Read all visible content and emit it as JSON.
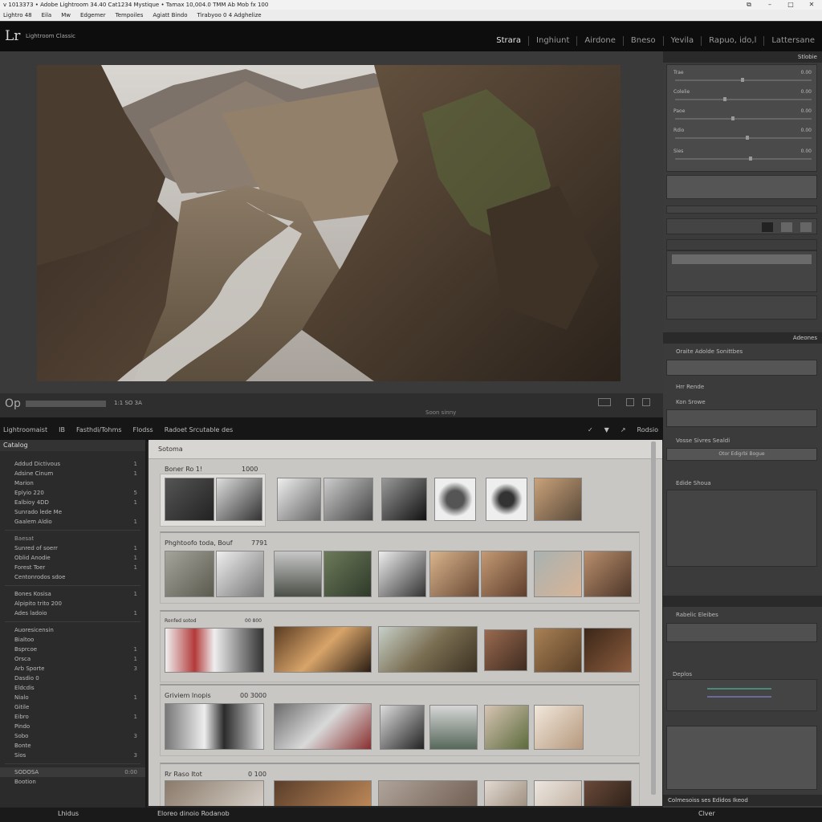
{
  "window": {
    "title": "v 1013373 • Adobe Lightroom 34.40 Cat1234 Mystique • Tamax 10,004.0 TMM Ab Mob fx 100",
    "controls": [
      "⧉",
      "–",
      "□",
      "✕"
    ]
  },
  "menubar": [
    "Lightro 48",
    "Eila",
    "Mw",
    "Edgemer",
    "Tempoiles",
    "Agiatt Bindo",
    "Tirabyoo 0 4 Adghelize"
  ],
  "identity": {
    "logo": "Lr",
    "brand": "Lightroom Classic",
    "modules": [
      "Strara",
      "Inghiunt",
      "Airdone",
      "Bneso",
      "Yevila",
      "Rapuo, ido,l",
      "Lattersane"
    ],
    "active_module": "Strara"
  },
  "toolbar": {
    "left_label": "Op",
    "zoom_text": "1:1 SO 3A",
    "center_text": "Soon sinny"
  },
  "filmstrip_bar": {
    "items": [
      "Lightroomaist",
      "IB",
      "Fasthdi/Tohms",
      "Flodss",
      "Radoet Srcutable des"
    ],
    "right": [
      "✓",
      "▼",
      "↗",
      "Rodsio"
    ]
  },
  "left_panel": {
    "header": "Catalog",
    "group1": [
      {
        "label": "Addud Dictivous",
        "count": "1"
      },
      {
        "label": "Adsine Cinum",
        "count": "1"
      },
      {
        "label": "Marion",
        "count": ""
      },
      {
        "label": "Eplyio 220",
        "count": "5"
      },
      {
        "label": "Ealbioy 4DD",
        "count": "1"
      },
      {
        "label": "Sunrado lede Me",
        "count": ""
      },
      {
        "label": "Gaalem Aldio",
        "count": "1"
      }
    ],
    "group2_label": "Baesat",
    "group2": [
      {
        "label": "Sunred of soerr",
        "count": "1"
      },
      {
        "label": "Oblid Anodie",
        "count": "1"
      },
      {
        "label": "Forest Toer",
        "count": "1"
      },
      {
        "label": "Centonrodos sdoe",
        "count": ""
      }
    ],
    "group3": [
      {
        "label": "Bones Kosisa",
        "count": "1"
      },
      {
        "label": "Alpipito trito 200",
        "count": ""
      },
      {
        "label": "Ades ladoio",
        "count": "1"
      }
    ],
    "group4_label": "Auoresicensin",
    "group4": [
      {
        "label": "Bialtoo",
        "count": ""
      },
      {
        "label": "Bsprcoe",
        "count": "1"
      },
      {
        "label": "Orsca",
        "count": "1"
      },
      {
        "label": "Arb Sporte",
        "count": "3"
      },
      {
        "label": "Dasdio 0",
        "count": ""
      },
      {
        "label": "Eldcdis",
        "count": ""
      },
      {
        "label": "Nialo",
        "count": "1"
      },
      {
        "label": "Gitile",
        "count": ""
      },
      {
        "label": "Eibro",
        "count": "1"
      },
      {
        "label": "Pindo",
        "count": ""
      },
      {
        "label": "Sobo",
        "count": "3"
      },
      {
        "label": "Bonte",
        "count": ""
      },
      {
        "label": "Sios",
        "count": "3"
      }
    ],
    "footer1": {
      "label": "SODOSA",
      "count": "0:00"
    },
    "footer2": "Bootion"
  },
  "grid": {
    "header": "Sotoma",
    "sections": [
      {
        "title": "Boner Ro 1!",
        "meta": "1000"
      },
      {
        "title": "Phghtoofo toda, Bouf",
        "meta": "7791"
      },
      {
        "title": "Ronfed sotod",
        "meta": "00 800"
      },
      {
        "title": "Griviem Inopis",
        "meta": "00 3000"
      },
      {
        "title": "Rr Raso Itot",
        "meta": "0 100"
      }
    ]
  },
  "right_panel": {
    "top_head": "Stlobie",
    "labels": [
      "Trae",
      "Colelie",
      "Paoe",
      "Rdio",
      "Sies"
    ],
    "values": [
      "0.00",
      "0.00",
      "0.00",
      "0.00",
      "0.00"
    ],
    "presets_head": "Adeones",
    "presets_title": "Oraite Adolde Sonittbes",
    "hr_theme": "Hrr Rende",
    "kon_shows": "Kon Srowe",
    "vosse": "Vosse Sivres Sealdi",
    "button1": "Otor Edigrbi Bogue",
    "section2": "Edide Shoua",
    "section3": "Rabelic Eleibes",
    "section4": "Deplos",
    "footer_head": "Colmesoiss ses Edidos Ikeod",
    "footer_btn": "Clver"
  },
  "bottom": {
    "left": "Lhidus",
    "center": "Eloreo dinoio Rodanob"
  }
}
